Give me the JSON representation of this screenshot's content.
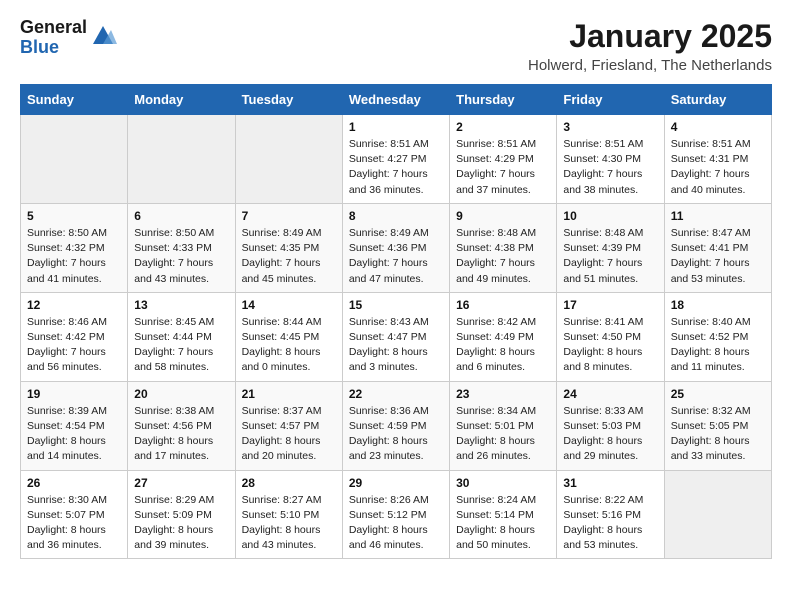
{
  "logo": {
    "general": "General",
    "blue": "Blue"
  },
  "header": {
    "month": "January 2025",
    "location": "Holwerd, Friesland, The Netherlands"
  },
  "weekdays": [
    "Sunday",
    "Monday",
    "Tuesday",
    "Wednesday",
    "Thursday",
    "Friday",
    "Saturday"
  ],
  "weeks": [
    [
      {
        "day": "",
        "info": ""
      },
      {
        "day": "",
        "info": ""
      },
      {
        "day": "",
        "info": ""
      },
      {
        "day": "1",
        "info": "Sunrise: 8:51 AM\nSunset: 4:27 PM\nDaylight: 7 hours and 36 minutes."
      },
      {
        "day": "2",
        "info": "Sunrise: 8:51 AM\nSunset: 4:29 PM\nDaylight: 7 hours and 37 minutes."
      },
      {
        "day": "3",
        "info": "Sunrise: 8:51 AM\nSunset: 4:30 PM\nDaylight: 7 hours and 38 minutes."
      },
      {
        "day": "4",
        "info": "Sunrise: 8:51 AM\nSunset: 4:31 PM\nDaylight: 7 hours and 40 minutes."
      }
    ],
    [
      {
        "day": "5",
        "info": "Sunrise: 8:50 AM\nSunset: 4:32 PM\nDaylight: 7 hours and 41 minutes."
      },
      {
        "day": "6",
        "info": "Sunrise: 8:50 AM\nSunset: 4:33 PM\nDaylight: 7 hours and 43 minutes."
      },
      {
        "day": "7",
        "info": "Sunrise: 8:49 AM\nSunset: 4:35 PM\nDaylight: 7 hours and 45 minutes."
      },
      {
        "day": "8",
        "info": "Sunrise: 8:49 AM\nSunset: 4:36 PM\nDaylight: 7 hours and 47 minutes."
      },
      {
        "day": "9",
        "info": "Sunrise: 8:48 AM\nSunset: 4:38 PM\nDaylight: 7 hours and 49 minutes."
      },
      {
        "day": "10",
        "info": "Sunrise: 8:48 AM\nSunset: 4:39 PM\nDaylight: 7 hours and 51 minutes."
      },
      {
        "day": "11",
        "info": "Sunrise: 8:47 AM\nSunset: 4:41 PM\nDaylight: 7 hours and 53 minutes."
      }
    ],
    [
      {
        "day": "12",
        "info": "Sunrise: 8:46 AM\nSunset: 4:42 PM\nDaylight: 7 hours and 56 minutes."
      },
      {
        "day": "13",
        "info": "Sunrise: 8:45 AM\nSunset: 4:44 PM\nDaylight: 7 hours and 58 minutes."
      },
      {
        "day": "14",
        "info": "Sunrise: 8:44 AM\nSunset: 4:45 PM\nDaylight: 8 hours and 0 minutes."
      },
      {
        "day": "15",
        "info": "Sunrise: 8:43 AM\nSunset: 4:47 PM\nDaylight: 8 hours and 3 minutes."
      },
      {
        "day": "16",
        "info": "Sunrise: 8:42 AM\nSunset: 4:49 PM\nDaylight: 8 hours and 6 minutes."
      },
      {
        "day": "17",
        "info": "Sunrise: 8:41 AM\nSunset: 4:50 PM\nDaylight: 8 hours and 8 minutes."
      },
      {
        "day": "18",
        "info": "Sunrise: 8:40 AM\nSunset: 4:52 PM\nDaylight: 8 hours and 11 minutes."
      }
    ],
    [
      {
        "day": "19",
        "info": "Sunrise: 8:39 AM\nSunset: 4:54 PM\nDaylight: 8 hours and 14 minutes."
      },
      {
        "day": "20",
        "info": "Sunrise: 8:38 AM\nSunset: 4:56 PM\nDaylight: 8 hours and 17 minutes."
      },
      {
        "day": "21",
        "info": "Sunrise: 8:37 AM\nSunset: 4:57 PM\nDaylight: 8 hours and 20 minutes."
      },
      {
        "day": "22",
        "info": "Sunrise: 8:36 AM\nSunset: 4:59 PM\nDaylight: 8 hours and 23 minutes."
      },
      {
        "day": "23",
        "info": "Sunrise: 8:34 AM\nSunset: 5:01 PM\nDaylight: 8 hours and 26 minutes."
      },
      {
        "day": "24",
        "info": "Sunrise: 8:33 AM\nSunset: 5:03 PM\nDaylight: 8 hours and 29 minutes."
      },
      {
        "day": "25",
        "info": "Sunrise: 8:32 AM\nSunset: 5:05 PM\nDaylight: 8 hours and 33 minutes."
      }
    ],
    [
      {
        "day": "26",
        "info": "Sunrise: 8:30 AM\nSunset: 5:07 PM\nDaylight: 8 hours and 36 minutes."
      },
      {
        "day": "27",
        "info": "Sunrise: 8:29 AM\nSunset: 5:09 PM\nDaylight: 8 hours and 39 minutes."
      },
      {
        "day": "28",
        "info": "Sunrise: 8:27 AM\nSunset: 5:10 PM\nDaylight: 8 hours and 43 minutes."
      },
      {
        "day": "29",
        "info": "Sunrise: 8:26 AM\nSunset: 5:12 PM\nDaylight: 8 hours and 46 minutes."
      },
      {
        "day": "30",
        "info": "Sunrise: 8:24 AM\nSunset: 5:14 PM\nDaylight: 8 hours and 50 minutes."
      },
      {
        "day": "31",
        "info": "Sunrise: 8:22 AM\nSunset: 5:16 PM\nDaylight: 8 hours and 53 minutes."
      },
      {
        "day": "",
        "info": ""
      }
    ]
  ]
}
